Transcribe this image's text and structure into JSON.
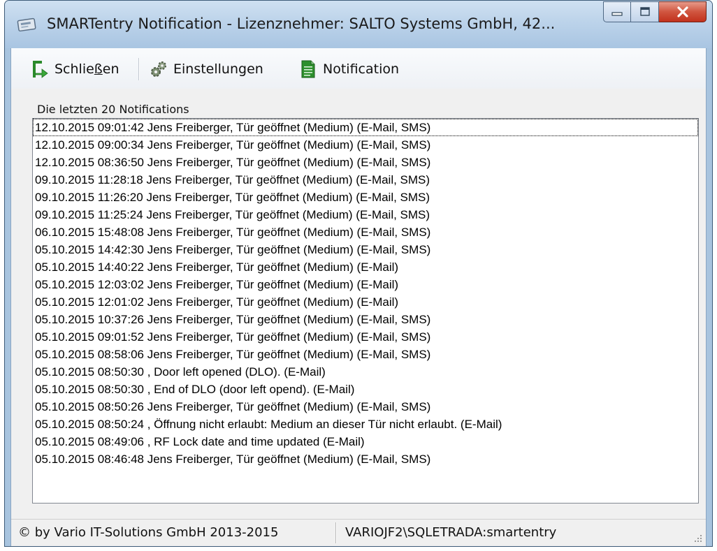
{
  "window": {
    "title": "SMARTentry Notification - Lizenznehmer: SALTO Systems GmbH, 42...",
    "icons": {
      "app": "notification-app-icon",
      "minimize": "minimize-icon",
      "maximize": "maximize-icon",
      "close": "close-icon"
    }
  },
  "toolbar": {
    "close_prefix": "Schlie",
    "close_accel": "ß",
    "close_suffix": "en",
    "close_icon": "exit-arrow-icon",
    "settings_label": "Einstellungen",
    "settings_icon": "gears-icon",
    "notification_label": "Notification",
    "notification_icon": "document-icon"
  },
  "list": {
    "label": "Die letzten 20 Notifications",
    "items": [
      "12.10.2015 09:01:42 Jens Freiberger, Tür geöffnet (Medium) (E-Mail, SMS)",
      "12.10.2015 09:00:34 Jens Freiberger, Tür geöffnet (Medium) (E-Mail, SMS)",
      "12.10.2015 08:36:50 Jens Freiberger, Tür geöffnet (Medium) (E-Mail, SMS)",
      "09.10.2015 11:28:18 Jens Freiberger, Tür geöffnet (Medium) (E-Mail, SMS)",
      "09.10.2015 11:26:20 Jens Freiberger, Tür geöffnet (Medium) (E-Mail, SMS)",
      "09.10.2015 11:25:24 Jens Freiberger, Tür geöffnet (Medium) (E-Mail, SMS)",
      "06.10.2015 15:48:08 Jens Freiberger, Tür geöffnet (Medium) (E-Mail, SMS)",
      "05.10.2015 14:42:30 Jens Freiberger, Tür geöffnet (Medium) (E-Mail, SMS)",
      "05.10.2015 14:40:22 Jens Freiberger, Tür geöffnet (Medium) (E-Mail)",
      "05.10.2015 12:03:02 Jens Freiberger, Tür geöffnet (Medium) (E-Mail)",
      "05.10.2015 12:01:02 Jens Freiberger, Tür geöffnet (Medium) (E-Mail)",
      "05.10.2015 10:37:26 Jens Freiberger, Tür geöffnet (Medium) (E-Mail, SMS)",
      "05.10.2015 09:01:52 Jens Freiberger, Tür geöffnet (Medium) (E-Mail, SMS)",
      "05.10.2015 08:58:06 Jens Freiberger, Tür geöffnet (Medium) (E-Mail, SMS)",
      "05.10.2015 08:50:30 , Door left opened (DLO). (E-Mail)",
      "05.10.2015 08:50:30 , End of DLO (door left opend). (E-Mail)",
      "05.10.2015 08:50:26 Jens Freiberger, Tür geöffnet (Medium) (E-Mail, SMS)",
      "05.10.2015 08:50:24 , Öffnung nicht erlaubt: Medium an dieser Tür nicht erlaubt. (E-Mail)",
      "05.10.2015 08:49:06 , RF Lock date and time updated (E-Mail)",
      "05.10.2015 08:46:48 Jens Freiberger, Tür geöffnet (Medium) (E-Mail, SMS)"
    ]
  },
  "statusbar": {
    "copyright": "© by Vario IT-Solutions GmbH 2013-2015",
    "connection": "VARIOJF2\\SQLETRADA:smartentry"
  }
}
